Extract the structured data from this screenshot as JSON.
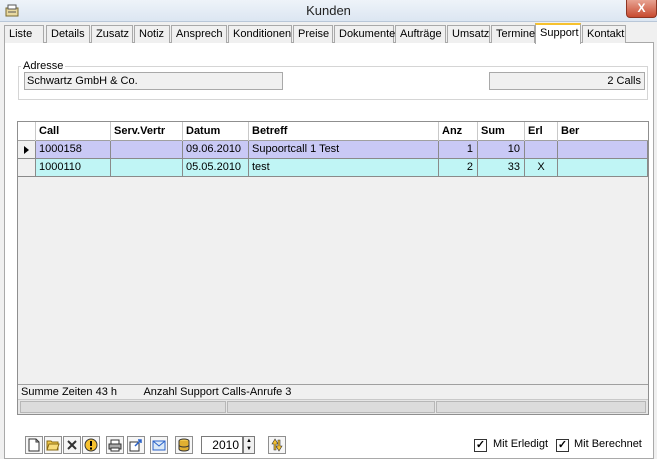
{
  "window": {
    "title": "Kunden",
    "close_glyph": "X"
  },
  "tabs": [
    {
      "label": "Liste"
    },
    {
      "label": "Details"
    },
    {
      "label": "Zusatz"
    },
    {
      "label": "Notiz"
    },
    {
      "label": "Ansprech"
    },
    {
      "label": "Konditionen"
    },
    {
      "label": "Preise"
    },
    {
      "label": "Dokumente"
    },
    {
      "label": "Aufträge"
    },
    {
      "label": "Umsatz"
    },
    {
      "label": "Termine"
    },
    {
      "label": "Support"
    },
    {
      "label": "Kontakt"
    }
  ],
  "active_tab": "Support",
  "address": {
    "legend": "Adresse",
    "value": "Schwartz GmbH  & Co.",
    "calls": "2 Calls"
  },
  "grid": {
    "columns": [
      "Call",
      "Serv.Vertr",
      "Datum",
      "Betreff",
      "Anz",
      "Sum",
      "Erl",
      "Ber"
    ],
    "rows": [
      {
        "call": "1000158",
        "serv": "",
        "datum": "09.06.2010",
        "betreff": "Supoortcall 1 Test",
        "anz": "1",
        "sum": "10",
        "erl": "",
        "ber": ""
      },
      {
        "call": "1000110",
        "serv": "",
        "datum": "05.05.2010",
        "betreff": "test",
        "anz": "2",
        "sum": "33",
        "erl": "X",
        "ber": ""
      }
    ],
    "row_colors": [
      "#c9c9f5",
      "#c0f5f5"
    ]
  },
  "status": {
    "summe": "Summe Zeiten 43 h",
    "anzahl": "Anzahl Support Calls-Anrufe 3"
  },
  "toolbar": {
    "icons": [
      "new-document-icon",
      "open-folder-icon",
      "delete-icon",
      "alert-icon",
      "print-icon",
      "export-icon",
      "email-icon",
      "database-icon"
    ],
    "year": "2010",
    "refresh_icon": "refresh-icon"
  },
  "filters": {
    "mit_erledigt": {
      "label": "Mit Erledigt",
      "checked": true,
      "mark": "✓"
    },
    "mit_berechnet": {
      "label": "Mit Berechnet",
      "checked": true,
      "mark": "✓"
    }
  },
  "colors": {
    "active_tab_accent": "#f6c12e",
    "close_button": "#c74a30"
  }
}
